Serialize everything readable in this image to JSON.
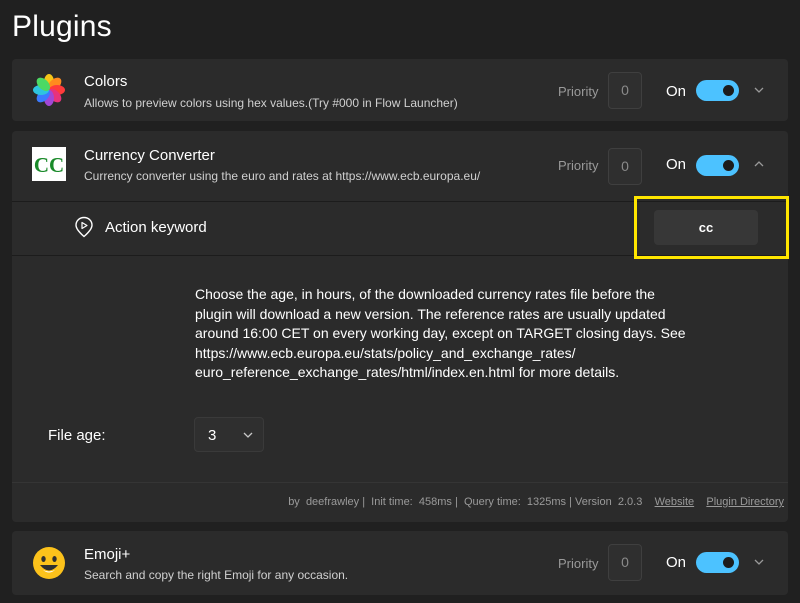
{
  "page": {
    "title": "Plugins"
  },
  "plugins": [
    {
      "name": "Colors",
      "description": "Allows to preview colors using hex values.(Try #000 in Flow Launcher)",
      "priority_label": "Priority",
      "priority": "0",
      "toggle_label": "On",
      "enabled": true,
      "expanded": false,
      "icon": "color-wheel-icon"
    },
    {
      "name": "Currency Converter",
      "description": "Currency converter using the euro and rates at https://www.ecb.europa.eu/",
      "priority_label": "Priority",
      "priority": "0",
      "toggle_label": "On",
      "enabled": true,
      "expanded": true,
      "icon": "cc-logo-icon",
      "icon_text": "CC",
      "action_keyword_label": "Action keyword",
      "action_keyword": "cc",
      "info_lines": [
        "Choose the age, in hours, of the downloaded currency rates file before the",
        "plugin will download a new version.  The reference rates are usually updated",
        "around 16:00 CET on every working day, except on TARGET closing days. See",
        "https://www.ecb.europa.eu/stats/policy_and_exchange_rates/",
        "euro_reference_exchange_rates/html/index.en.html for more details."
      ],
      "file_age_label": "File age:",
      "file_age_value": "3",
      "footer": {
        "author_prefix": "by",
        "author": "deefrawley",
        "init_label": "Init time:",
        "init_time": "458ms",
        "query_label": "Query time:",
        "query_time": "1325ms",
        "version_label": "Version",
        "version": "2.0.3",
        "website_link": "Website",
        "directory_link": "Plugin Directory"
      }
    },
    {
      "name": "Emoji+",
      "description": "Search and copy the right Emoji for any occasion.",
      "priority_label": "Priority",
      "priority": "0",
      "toggle_label": "On",
      "enabled": true,
      "expanded": false,
      "icon": "smiley-emoji-icon"
    }
  ],
  "colors": {
    "background": "#202020",
    "card": "#2b2b2b",
    "accent": "#4cc2ff",
    "highlight": "#ffe600"
  }
}
